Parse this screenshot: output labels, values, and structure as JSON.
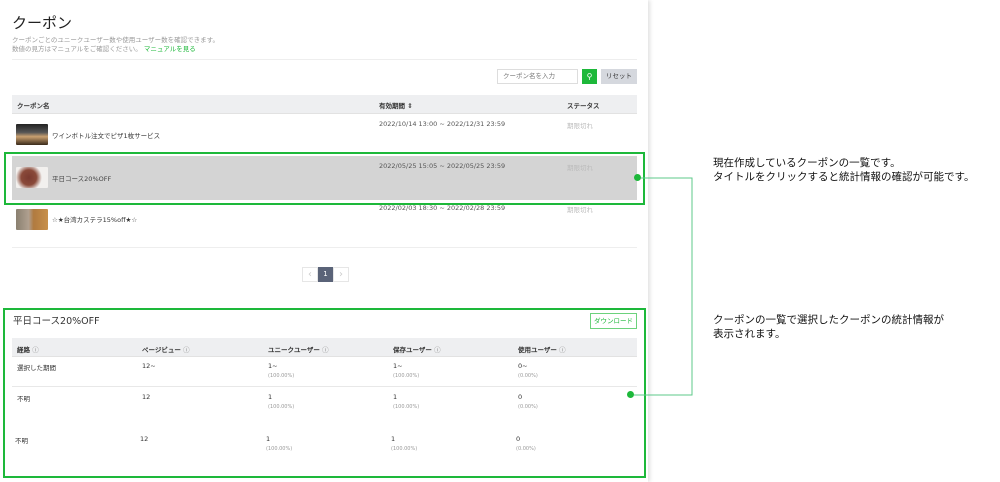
{
  "page": {
    "title": "クーポン",
    "desc_line1": "クーポンごとのユニークユーザー数や使用ユーザー数を確認できます。",
    "desc_line2": "数値の見方はマニュアルをご確認ください。",
    "manual_link": "マニュアルを見る"
  },
  "search": {
    "placeholder": "クーポン名を入力",
    "reset_label": "リセット"
  },
  "coupon_table": {
    "headers": [
      "クーポン名",
      "有効期間 ⇕",
      "ステータス"
    ],
    "rows": [
      {
        "name": "ワインボトル注文でピザ1枚サービス",
        "period": "2022/10/14 13:00 ~ 2022/12/31 23:59",
        "status": "期限切れ"
      },
      {
        "name": "平日コース20%OFF",
        "period": "2022/05/25 15:05 ~ 2022/05/25 23:59",
        "status": "期限切れ"
      },
      {
        "name": "☆★台湾カステラ15%off★☆",
        "period": "2022/02/03 18:30 ~ 2022/02/28 23:59",
        "status": "期限切れ"
      }
    ]
  },
  "pagination": {
    "current": "1",
    "prev": "‹",
    "next": "›"
  },
  "stats": {
    "title": "平日コース20%OFF",
    "download_label": "ダウンロード",
    "headers": [
      "経路",
      "ページビュー",
      "ユニークユーザー",
      "保存ユーザー",
      "使用ユーザー"
    ],
    "rows": [
      {
        "route": "選択した期間",
        "pv": "12~",
        "uu": "1~",
        "uu_pct": "(100.00%)",
        "saved": "1~",
        "saved_pct": "(100.00%)",
        "used": "0~",
        "used_pct": "(0.00%)"
      },
      {
        "route": "不明",
        "pv": "12",
        "uu": "1",
        "uu_pct": "(100.00%)",
        "saved": "1",
        "saved_pct": "(100.00%)",
        "used": "0",
        "used_pct": "(0.00%)"
      },
      {
        "route": "不明",
        "pv": "12",
        "uu": "1",
        "uu_pct": "(100.00%)",
        "saved": "1",
        "saved_pct": "(100.00%)",
        "used": "0",
        "used_pct": "(0.00%)"
      }
    ]
  },
  "annotations": {
    "list_line1": "現在作成しているクーポンの一覧です。",
    "list_line2": "タイトルをクリックすると統計情報の確認が可能です。",
    "stats_line1": "クーポンの一覧で選択したクーポンの統計情報が",
    "stats_line2": "表示されます。"
  },
  "colors": {
    "accent": "#1db83a",
    "page_active": "#5a6378"
  }
}
